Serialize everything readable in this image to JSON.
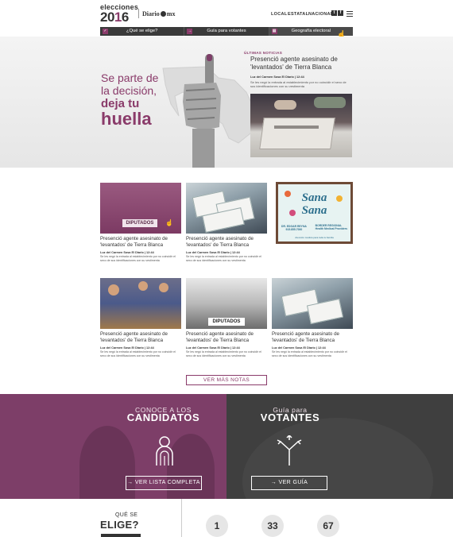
{
  "header": {
    "logo_line1": "elecciones",
    "logo_year_a": "20",
    "logo_year_b": "1",
    "logo_year_c": "6",
    "partner_a": "Diario",
    "partner_b": "mx",
    "nav": [
      "LOCAL",
      "ESTATAL",
      "NACIONAL"
    ],
    "social": [
      "t",
      "f"
    ]
  },
  "navbar": {
    "items": [
      {
        "icon": "checkbox-icon",
        "label": "¿Qué se elige?"
      },
      {
        "icon": "arrow-right-icon",
        "label": "Guía para votantes"
      },
      {
        "icon": "map-icon",
        "label": "Geografía electoral"
      }
    ]
  },
  "hero": {
    "tagline1": "Se parte de",
    "tagline2": "la decisión,",
    "tagline3": "deja tu",
    "tagline4": "huella",
    "news_label": "ÚLTIMAS NOTICIAS",
    "news_title": "Presenció agente asesinato de 'levantados' de Tierra Blanca",
    "news_meta": "Luz del Carmen Sosa El Diario | 12:44",
    "news_desc": "Se les negó la entrada al establecimiento por no coincidir el sexo de sus identificaciones con su vestimenta"
  },
  "cards": [
    {
      "title": "Presenció agente asesinato de 'levantados' de Tierra Blanca",
      "meta": "Luz del Carmen Sosa El Diario | 12:44",
      "desc": "Se les negó la entrada al establecimiento por no coincidir el sexo de sus identificaciones con su vestimenta",
      "thumb_text": "DIPUTADOS"
    },
    {
      "title": "Presenció agente asesinato de 'levantados' de Tierra Blanca",
      "meta": "Luz del Carmen Sosa El Diario | 12:44",
      "desc": "Se les negó la entrada al establecimiento por no coincidir el sexo de sus identificaciones con su vestimenta"
    },
    {
      "title": "Presenció agente asesinato de 'levantados' de Tierra Blanca",
      "meta": "Luz del Carmen Sosa El Diario | 12:44",
      "desc": "Se les negó la entrada al establecimiento por no coincidir el sexo de sus identificaciones con su vestimenta"
    },
    {
      "title": "Presenció agente asesinato de 'levantados' de Tierra Blanca",
      "meta": "Luz del Carmen Sosa El Diario | 12:44",
      "desc": "Se les negó la entrada al establecimiento por no coincidir el sexo de sus identificaciones con su vestimenta",
      "thumb_text": "DIPUTADOS"
    },
    {
      "title": "Presenció agente asesinato de 'levantados' de Tierra Blanca",
      "meta": "Luz del Carmen Sosa El Diario | 12:44",
      "desc": "Se les negó la entrada al establecimiento por no coincidir el sexo de sus identificaciones con su vestimenta"
    }
  ],
  "ad": {
    "title1": "Sana",
    "title2": "Sana",
    "doctor": "DR. EDGAR REYNA",
    "phone": "915.855.7000",
    "brand1": "BORDER REGIONAL",
    "brand2": "Health Medical Providers",
    "footer": "Atención médica para toda tu familia"
  },
  "more_button": "VER MÁS NOTAS",
  "panels": {
    "left": {
      "sub": "CONOCE A LOS",
      "main": "CANDIDATOS",
      "button": "→ VER LISTA COMPLETA"
    },
    "right": {
      "sub": "Guía para",
      "main": "VOTANTES",
      "button": "→ VER GUÍA"
    }
  },
  "bottom": {
    "q1": "QUÉ SE",
    "q2": "ELIGE?",
    "numbers": [
      "1",
      "33",
      "67"
    ]
  },
  "colors": {
    "accent": "#8a3b6a",
    "dark": "#3f3f3f"
  }
}
